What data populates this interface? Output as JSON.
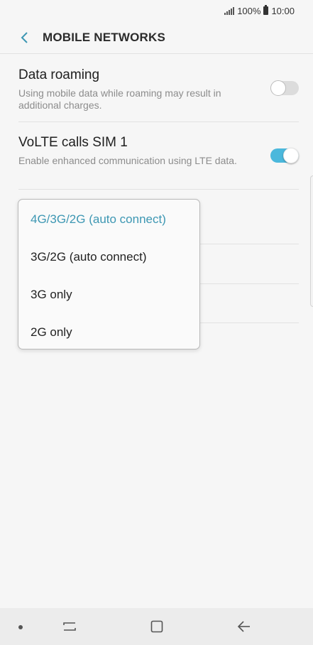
{
  "status_bar": {
    "battery": "100%",
    "time": "10:00"
  },
  "header": {
    "title": "MOBILE NETWORKS"
  },
  "settings": {
    "data_roaming": {
      "title": "Data roaming",
      "description": "Using mobile data while roaming may result in additional charges.",
      "enabled": false
    },
    "volte": {
      "title": "VoLTE calls SIM 1",
      "description": "Enable enhanced communication using LTE data.",
      "enabled": true
    }
  },
  "network_mode_dropdown": {
    "options": [
      {
        "label": "4G/3G/2G (auto connect)",
        "selected": true
      },
      {
        "label": "3G/2G (auto connect)",
        "selected": false
      },
      {
        "label": "3G only",
        "selected": false
      },
      {
        "label": "2G only",
        "selected": false
      }
    ]
  },
  "colors": {
    "accent": "#4bb8dc",
    "selected_text": "#3d97b3",
    "background": "#f6f6f6"
  },
  "icons": {
    "back": "chevron-left-icon",
    "signal": "signal-icon",
    "battery": "battery-icon",
    "recent": "recent-apps-icon",
    "home": "home-icon",
    "nav_back": "back-arrow-icon"
  }
}
